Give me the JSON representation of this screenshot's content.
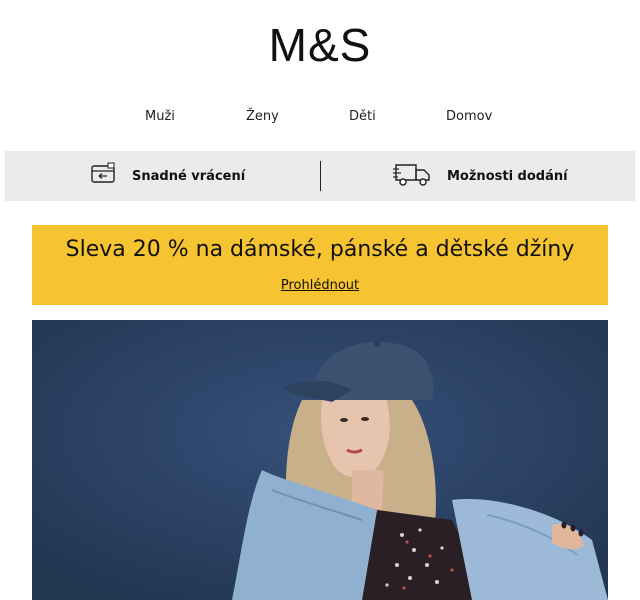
{
  "brand": {
    "logo_text": "M&S"
  },
  "nav": {
    "items": [
      {
        "label": "Muži"
      },
      {
        "label": "Ženy"
      },
      {
        "label": "Děti"
      },
      {
        "label": "Domov"
      }
    ]
  },
  "benefits": {
    "returns_label": "Snadné vrácení",
    "returns_icon": "return-card-icon",
    "delivery_label": "Možnosti dodání",
    "delivery_icon": "delivery-truck-icon"
  },
  "promo": {
    "headline": "Sleva 20 % na dámské, pánské a dětské džíny",
    "cta_label": "Prohlédnout",
    "background": "#f7c431"
  },
  "hero": {
    "background": "#2c4361",
    "image_subject": "woman in denim jacket and denim cap"
  }
}
